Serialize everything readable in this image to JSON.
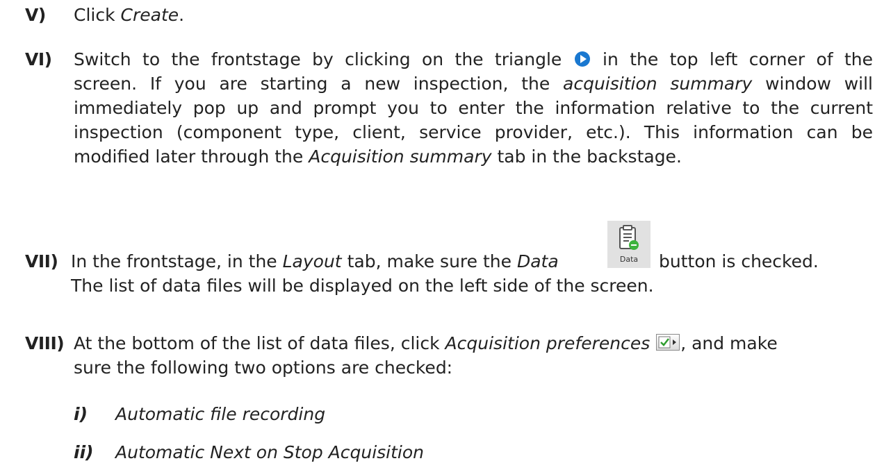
{
  "steps": [
    {
      "num": "V)",
      "parts": [
        "Click ",
        "Create",
        "."
      ]
    },
    {
      "num": "VI)",
      "line1": "Switch to the frontstage by clicking on the triangle",
      "line1_after": "in the top left corner of the",
      "rest_before": "screen. If you are starting a new inspection, the",
      "rest_em1": "acquisition summary",
      "rest_mid": "window will immediately pop up and prompt you to enter the information relative to the current inspection (component type, client, service provider, etc.). This information can be modified later through the",
      "rest_em2": "Acquisition summary",
      "rest_after": "tab in the backstage.",
      "icon": "play-triangle-icon",
      "icon_color": "#1a78d0"
    },
    {
      "num": "VII)",
      "a": "In the frontstage, in the",
      "em1": "Layout",
      "b": "tab, make sure the",
      "em2": "Data",
      "c": "button is checked.",
      "line2": "The list of data files will be displayed on the left side of the screen.",
      "button_label": "Data",
      "icon": "data-clipboard-icon"
    },
    {
      "num": "VIII)",
      "a": "At the bottom of the list of data files, click",
      "em1": "Acquisition preferences",
      "b": ", and make",
      "line2": "sure the following two options are checked:",
      "icon": "acquisition-preferences-icon"
    }
  ],
  "subitems": [
    {
      "num": "i)",
      "text": "Automatic file recording"
    },
    {
      "num": "ii)",
      "text": "Automatic Next on Stop Acquisition"
    }
  ]
}
